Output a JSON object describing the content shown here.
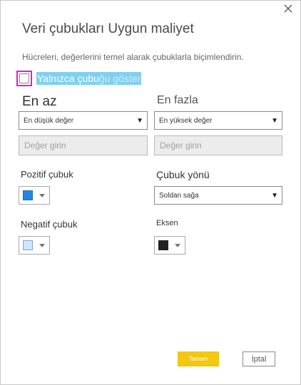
{
  "dialog": {
    "title": "Veri çubukları Uygun maliyet",
    "description": "Hücreleri, değerlerini temel alarak çubuklarla biçimlendirin.",
    "bars_only_label": "Yalnızca çubu",
    "bars_only_label_faded": "ğu göster",
    "bars_only_checked": false
  },
  "minimum": {
    "title": "En az",
    "type_value": "En düşük değer",
    "value_placeholder": "Değer girin"
  },
  "maximum": {
    "title": "En fazla",
    "type_value": "En yüksek değer",
    "value_placeholder": "Değer girin"
  },
  "positive_bar": {
    "label": "Pozitif çubuk",
    "color": "#1e8ae6"
  },
  "bar_direction": {
    "label": "Çubuk yönü",
    "value": "Soldan sağa"
  },
  "negative_bar": {
    "label": "Negatif çubuk",
    "color": "#cfe6fb"
  },
  "axis": {
    "label": "Eksen",
    "color": "#222222"
  },
  "buttons": {
    "ok": "Tamam",
    "cancel": "İptal"
  },
  "colors": {
    "accent": "#f2c811",
    "highlight": "#e51ad6"
  }
}
